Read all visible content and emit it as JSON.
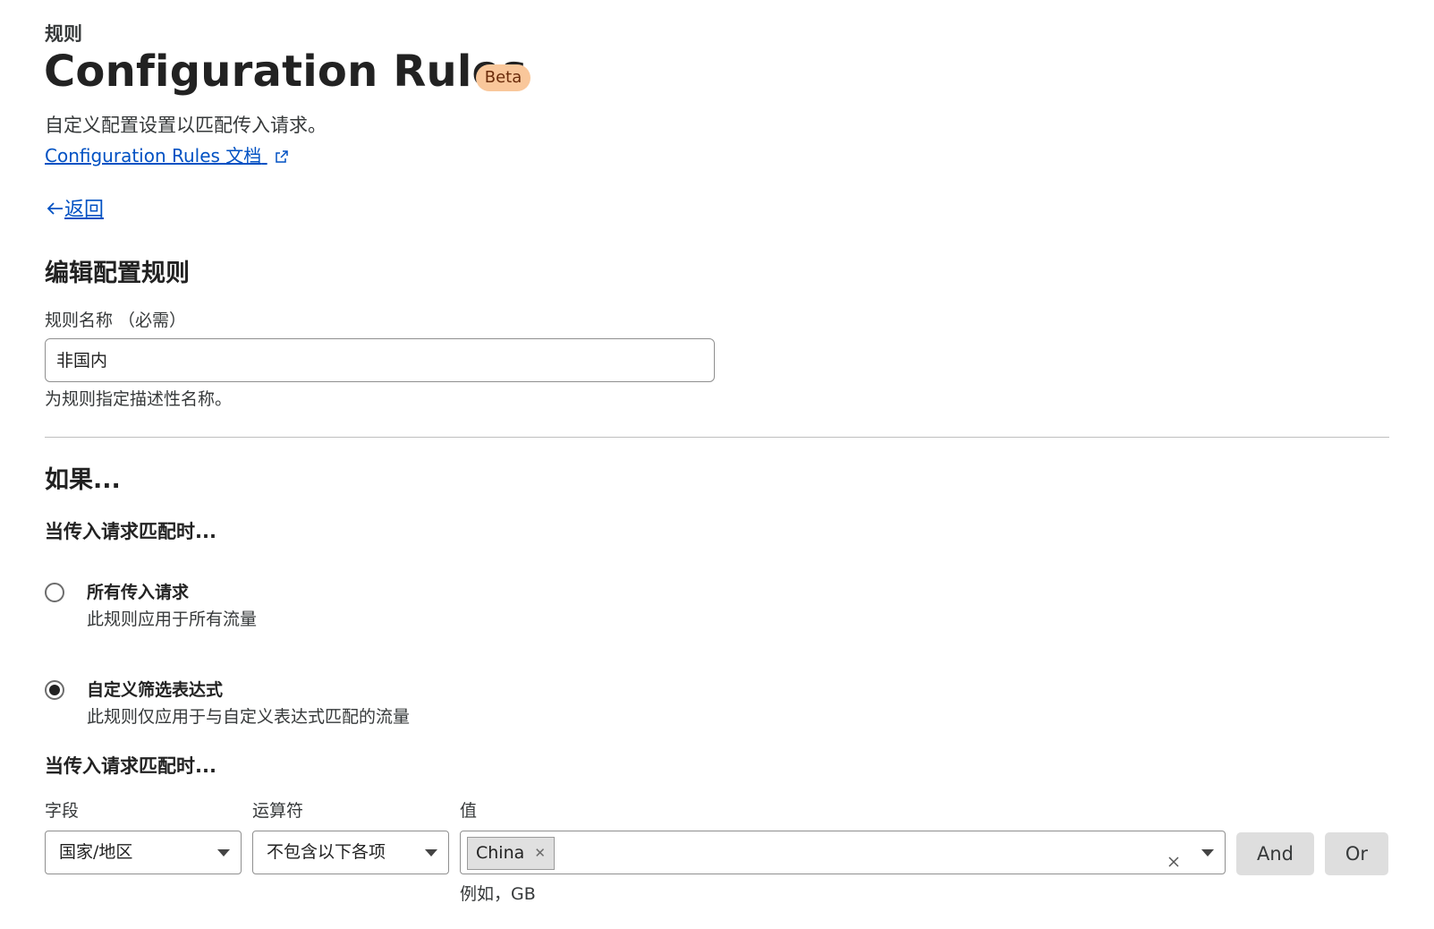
{
  "header": {
    "breadcrumb": "规则",
    "title": "Configuration Rules",
    "badge": "Beta",
    "subtitle": "自定义配置设置以匹配传入请求。",
    "doc_link": "Configuration Rules 文档"
  },
  "nav": {
    "back_label": "返回"
  },
  "edit": {
    "heading": "编辑配置规则",
    "name_label": "规则名称 （必需）",
    "name_value": "非国内",
    "name_help": "为规则指定描述性名称。"
  },
  "condition": {
    "heading": "如果...",
    "subheading": "当传入请求匹配时...",
    "options": [
      {
        "title": "所有传入请求",
        "desc": "此规则应用于所有流量",
        "selected": false
      },
      {
        "title": "自定义筛选表达式",
        "desc": "此规则仅应用于与自定义表达式匹配的流量",
        "selected": true
      }
    ],
    "expression_heading": "当传入请求匹配时...",
    "field_label": "字段",
    "operator_label": "运算符",
    "value_label": "值",
    "field_value": "国家/地区",
    "operator_value": "不包含以下各项",
    "value_chip": "China",
    "value_help": "例如，GB",
    "and_label": "And",
    "or_label": "Or"
  },
  "icons": {
    "external_link": "external-link-icon",
    "back_arrow": "arrow-left-icon",
    "dropdown": "chevron-down-icon",
    "clear": "close-icon"
  },
  "colors": {
    "link": "#0051c3",
    "badge_bg": "#f9c79b",
    "button_bg": "#dedede"
  }
}
